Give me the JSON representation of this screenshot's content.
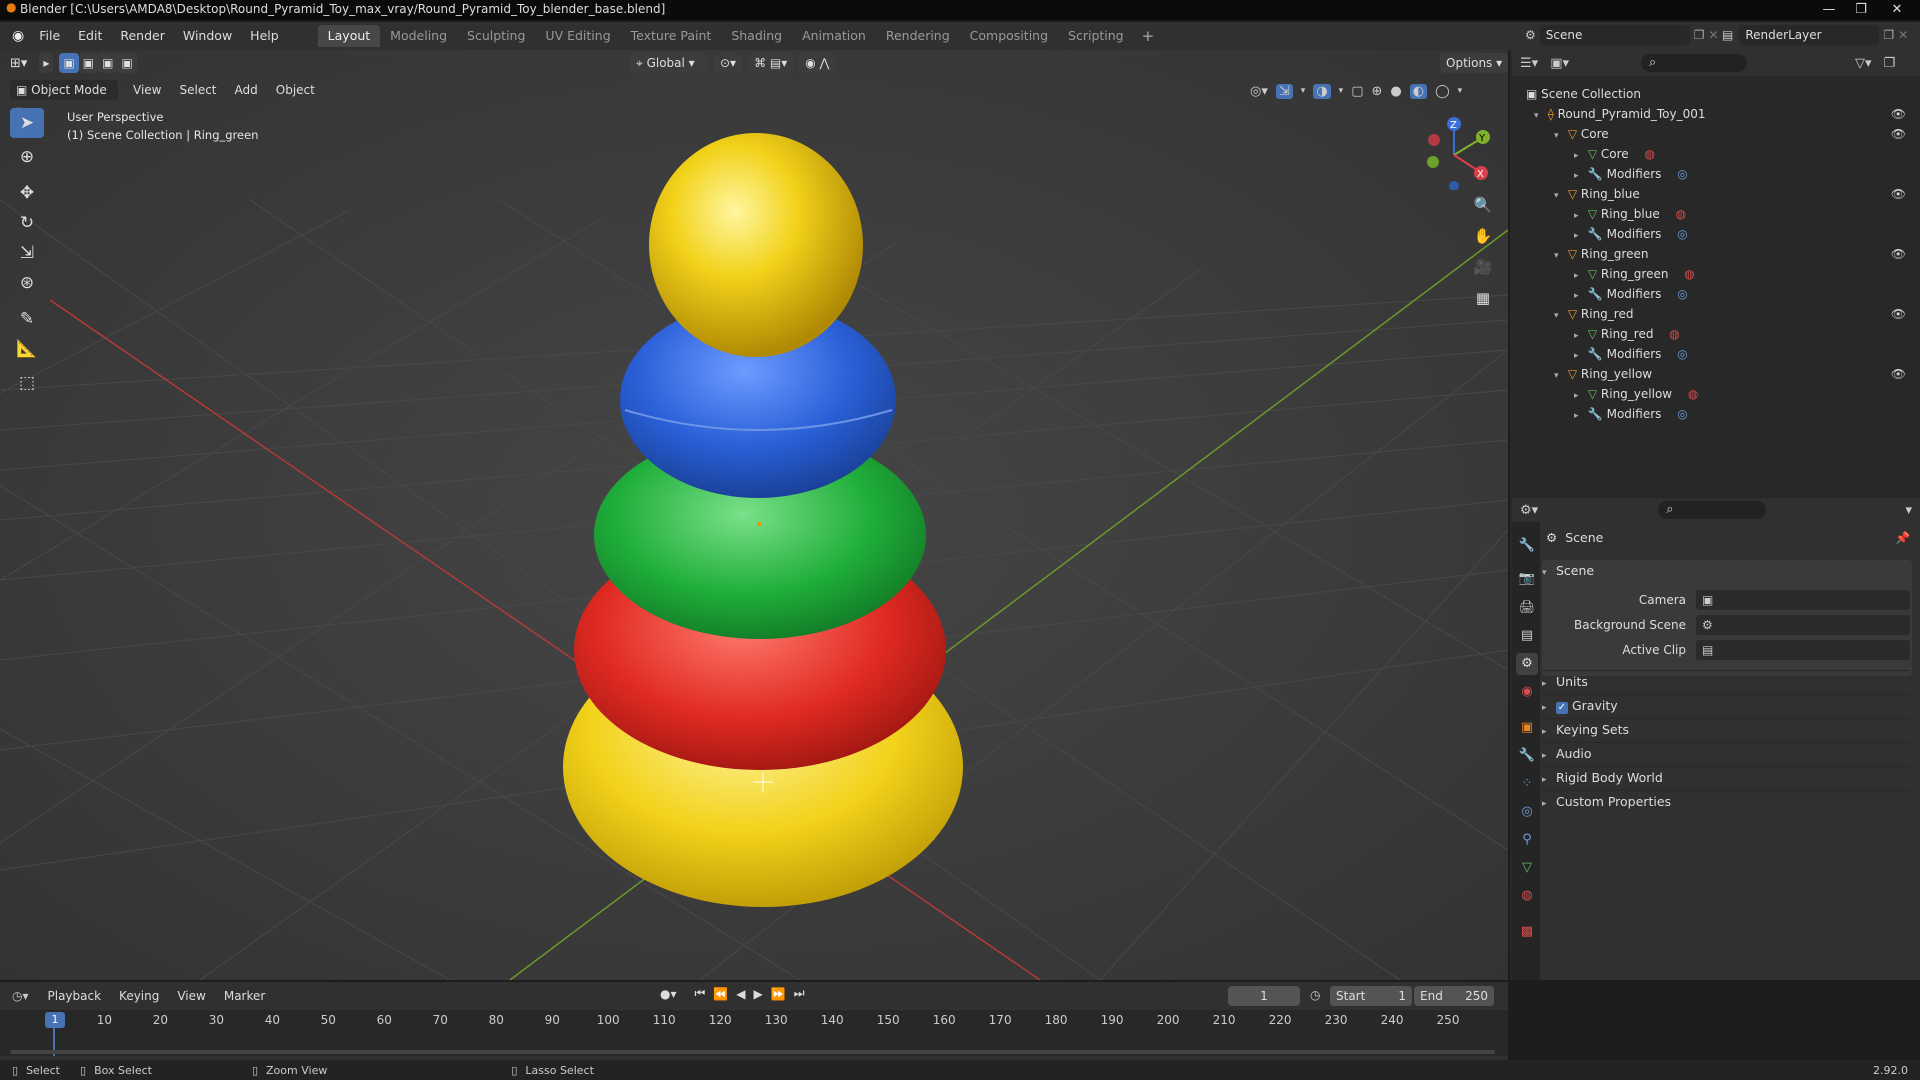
{
  "titlebar": {
    "title": "Blender [C:\\Users\\AMDA8\\Desktop\\Round_Pyramid_Toy_max_vray/Round_Pyramid_Toy_blender_base.blend]"
  },
  "menu": [
    "File",
    "Edit",
    "Render",
    "Window",
    "Help"
  ],
  "workspaces": [
    "Layout",
    "Modeling",
    "Sculpting",
    "UV Editing",
    "Texture Paint",
    "Shading",
    "Animation",
    "Rendering",
    "Compositing",
    "Scripting"
  ],
  "scene_selector": {
    "scene": "Scene",
    "view_layer": "RenderLayer"
  },
  "viewport": {
    "mode": "Object Mode",
    "menus": [
      "View",
      "Select",
      "Add",
      "Object"
    ],
    "orientation": "Global",
    "options": "Options",
    "overlay_line1": "User Perspective",
    "overlay_line2": "(1) Scene Collection | Ring_green",
    "gizmo": {
      "z": "Z",
      "y": "Y",
      "x": "X"
    }
  },
  "outliner": {
    "root": "Scene Collection",
    "collection": "Round_Pyramid_Toy_001",
    "objects": [
      {
        "name": "Core",
        "mesh": "Core",
        "modifiers": "Modifiers"
      },
      {
        "name": "Ring_blue",
        "mesh": "Ring_blue",
        "modifiers": "Modifiers"
      },
      {
        "name": "Ring_green",
        "mesh": "Ring_green",
        "modifiers": "Modifiers"
      },
      {
        "name": "Ring_red",
        "mesh": "Ring_red",
        "modifiers": "Modifiers"
      },
      {
        "name": "Ring_yellow",
        "mesh": "Ring_yellow",
        "modifiers": "Modifiers"
      }
    ]
  },
  "properties": {
    "context": "Scene",
    "section": "Scene",
    "fields": [
      {
        "label": "Camera",
        "value": ""
      },
      {
        "label": "Background Scene",
        "value": ""
      },
      {
        "label": "Active Clip",
        "value": ""
      }
    ],
    "panels": [
      "Units",
      "Gravity",
      "Keying Sets",
      "Audio",
      "Rigid Body World",
      "Custom Properties"
    ],
    "gravity_checked": true
  },
  "timeline": {
    "menus": [
      "Playback",
      "Keying",
      "View",
      "Marker"
    ],
    "current_frame": "1",
    "start_label": "Start",
    "start": "1",
    "end_label": "End",
    "end": "250",
    "ticks": [
      "1",
      "10",
      "20",
      "30",
      "40",
      "50",
      "60",
      "70",
      "80",
      "90",
      "100",
      "110",
      "120",
      "130",
      "140",
      "150",
      "160",
      "170",
      "180",
      "190",
      "200",
      "210",
      "220",
      "230",
      "240",
      "250"
    ]
  },
  "statusbar": {
    "select": "Select",
    "box_select": "Box Select",
    "zoom_view": "Zoom View",
    "lasso_select": "Lasso Select",
    "version": "2.92.0"
  },
  "colors": {
    "accent": "#4772b3",
    "ring_yellow": "#f2d21a",
    "ring_red": "#e02a22",
    "ring_green": "#1fae3a",
    "ring_blue": "#2a60d8"
  }
}
